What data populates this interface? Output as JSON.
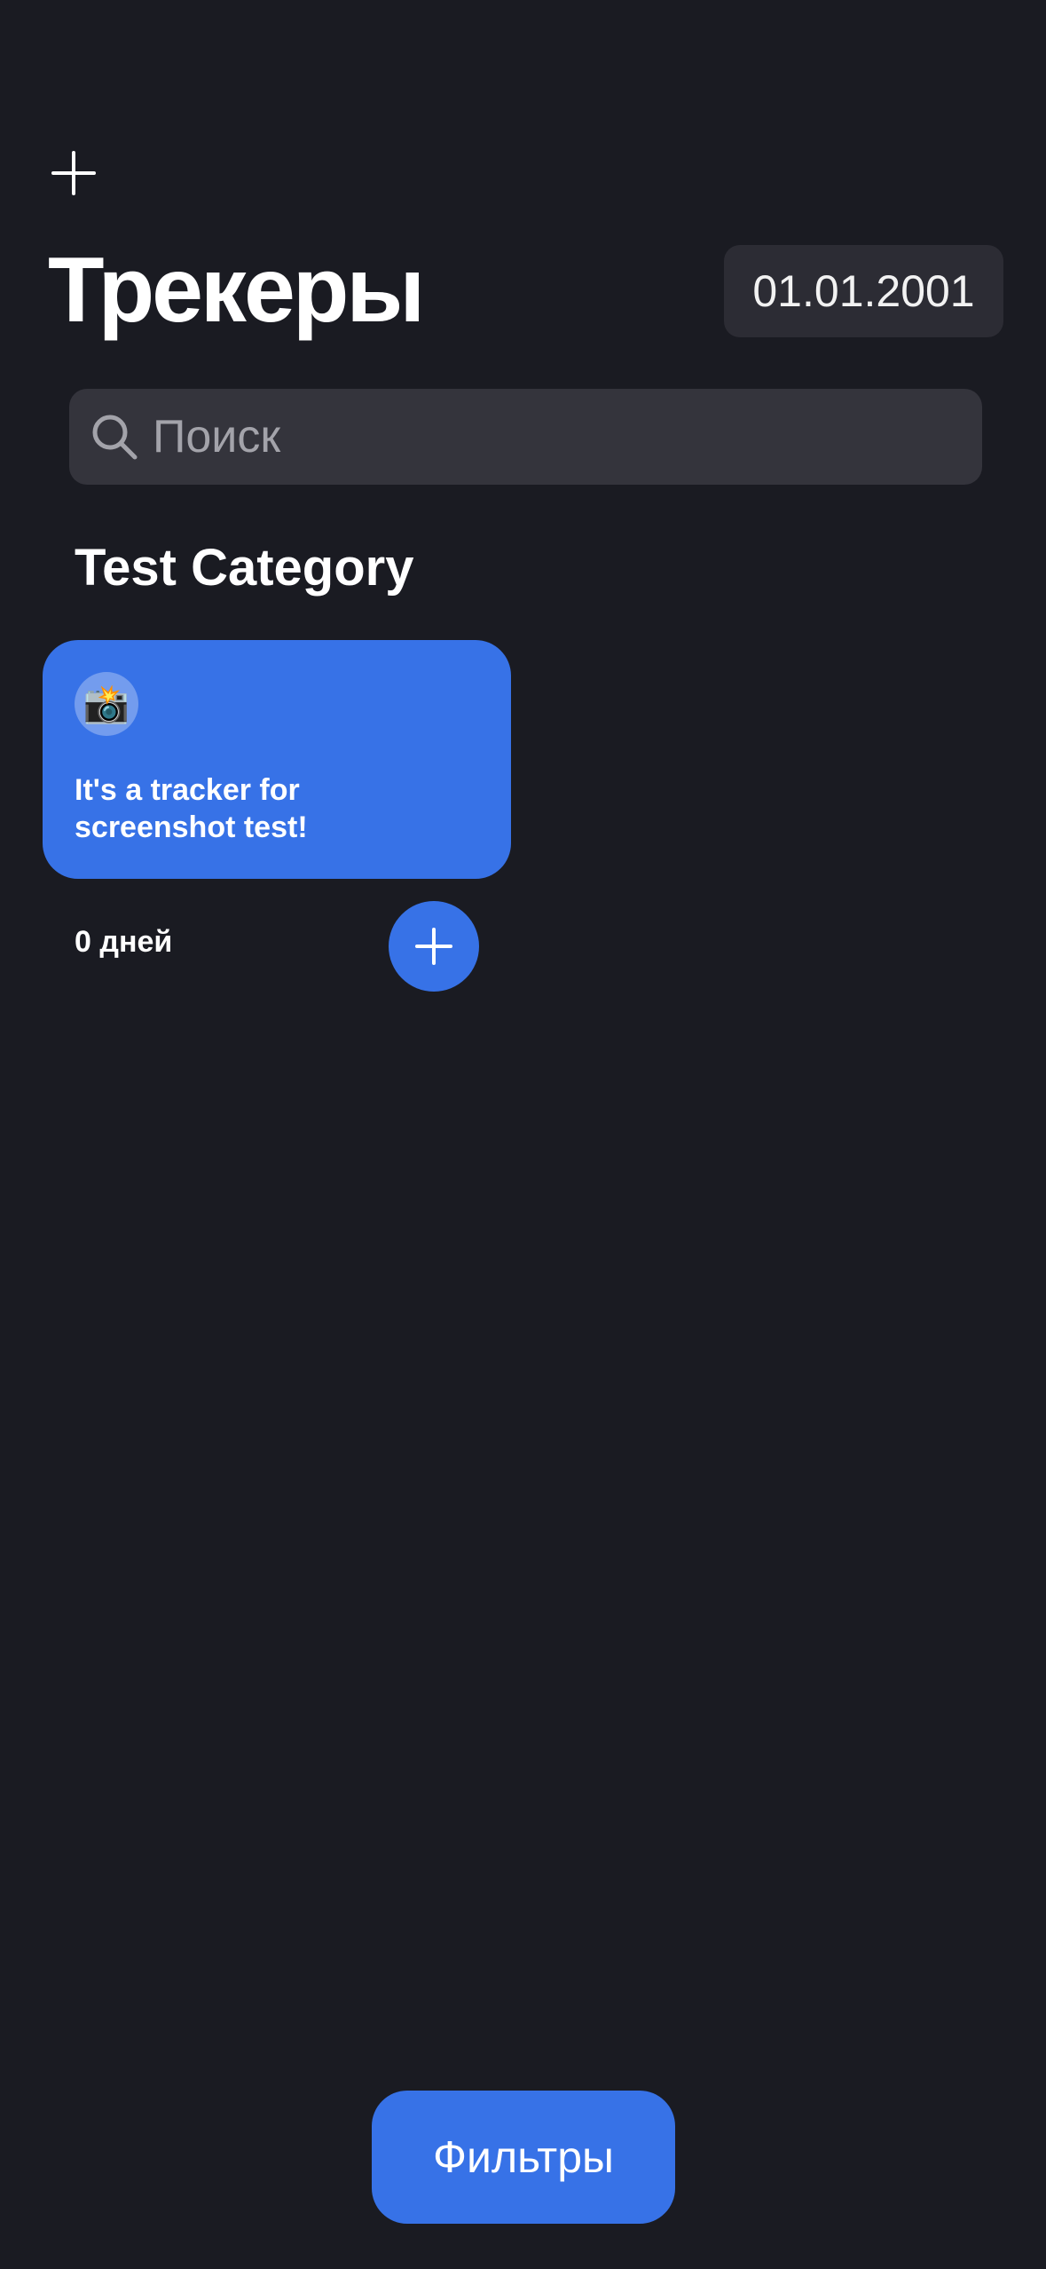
{
  "header": {
    "add_icon": "plus-icon",
    "title": "Трекеры",
    "date": "01.01.2001"
  },
  "search": {
    "icon": "search-icon",
    "placeholder": "Поиск",
    "value": ""
  },
  "categories": [
    {
      "title": "Test Category",
      "trackers": [
        {
          "emoji": "📸",
          "name": "It's a tracker for screenshot test!",
          "days": "0 дней",
          "color": "#3772E7",
          "action_icon": "plus-icon"
        }
      ]
    }
  ],
  "footer": {
    "filters_label": "Фильтры"
  },
  "colors": {
    "background": "#1A1B22",
    "accent": "#3772E7",
    "surface": "#2C2C34"
  }
}
